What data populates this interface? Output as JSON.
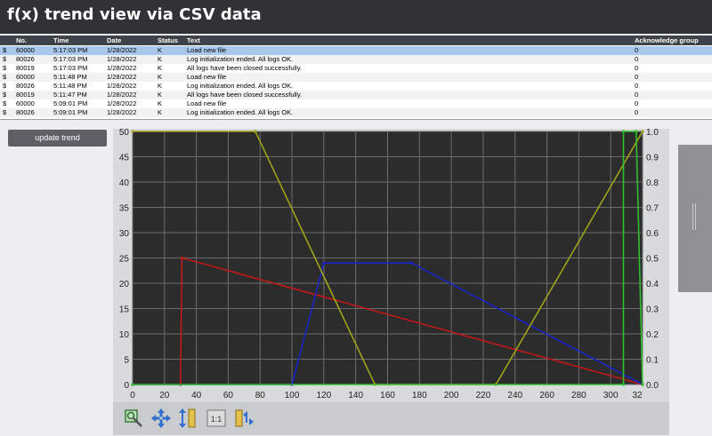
{
  "window": {
    "title": "f(x) trend view via CSV data"
  },
  "log_table": {
    "columns": [
      "No.",
      "Time",
      "Date",
      "Status",
      "Text",
      "Acknowledge group"
    ],
    "rows": [
      {
        "icon": "$",
        "no": "60000",
        "time": "5:17:03 PM",
        "date": "1/28/2022",
        "status": "K",
        "text": "Load new file",
        "ack": "0"
      },
      {
        "icon": "$",
        "no": "80026",
        "time": "5:17:03 PM",
        "date": "1/28/2022",
        "status": "K",
        "text": "Log initialization ended. All logs OK.",
        "ack": "0"
      },
      {
        "icon": "$",
        "no": "80019",
        "time": "5:17:03 PM",
        "date": "1/28/2022",
        "status": "K",
        "text": "All logs have been closed successfully.",
        "ack": "0"
      },
      {
        "icon": "$",
        "no": "60000",
        "time": "5:11:48 PM",
        "date": "1/28/2022",
        "status": "K",
        "text": "Load new file",
        "ack": "0"
      },
      {
        "icon": "$",
        "no": "80026",
        "time": "5:11:48 PM",
        "date": "1/28/2022",
        "status": "K",
        "text": "Log initialization ended. All logs OK.",
        "ack": "0"
      },
      {
        "icon": "$",
        "no": "80019",
        "time": "5:11:47 PM",
        "date": "1/28/2022",
        "status": "K",
        "text": "All logs have been closed successfully.",
        "ack": "0"
      },
      {
        "icon": "$",
        "no": "60000",
        "time": "5:09:01 PM",
        "date": "1/28/2022",
        "status": "K",
        "text": "Load new file",
        "ack": "0"
      },
      {
        "icon": "$",
        "no": "80026",
        "time": "5:09:01 PM",
        "date": "1/28/2022",
        "status": "K",
        "text": "Log initialization ended. All logs OK.",
        "ack": "0"
      }
    ]
  },
  "update_button": "update trend",
  "toolbar_icons": [
    "zoom-area-icon",
    "pan-icon",
    "zoom-y-icon",
    "reset-zoom-icon",
    "zoom-x-icon"
  ],
  "toolbar_reset_label": "1:1",
  "chart_data": {
    "type": "line",
    "background": "#2c2c2c",
    "grid": true,
    "x_ticks": [
      "0",
      "20",
      "40",
      "60",
      "80",
      "100",
      "120",
      "140",
      "160",
      "180",
      "200",
      "220",
      "240",
      "260",
      "280",
      "300",
      "32"
    ],
    "x_range": [
      0,
      320
    ],
    "y_left_ticks": [
      "0",
      "5",
      "10",
      "15",
      "20",
      "25",
      "30",
      "35",
      "40",
      "45",
      "50"
    ],
    "y_left_range": [
      0,
      50
    ],
    "y_right_ticks": [
      "0.0",
      "0.1",
      "0.2",
      "0.3",
      "0.4",
      "0.5",
      "0.6",
      "0.7",
      "0.8",
      "0.9",
      "1.0"
    ],
    "y_right_range": [
      0,
      1
    ],
    "series": [
      {
        "color": "#c21818",
        "axis": "left",
        "points": [
          [
            0,
            0
          ],
          [
            30,
            0
          ],
          [
            31,
            25
          ],
          [
            320,
            0
          ]
        ]
      },
      {
        "color": "#1a25c8",
        "axis": "left",
        "points": [
          [
            0,
            0
          ],
          [
            100,
            0
          ],
          [
            120,
            24
          ],
          [
            175,
            24
          ],
          [
            320,
            0
          ]
        ]
      },
      {
        "color": "#9fa31a",
        "axis": "right",
        "points": [
          [
            0,
            1
          ],
          [
            77,
            1
          ],
          [
            152,
            0
          ],
          [
            228,
            0
          ],
          [
            320,
            1
          ]
        ]
      },
      {
        "color": "#2fbf2f",
        "axis": "right",
        "points": [
          [
            0,
            0
          ],
          [
            308,
            0
          ],
          [
            308,
            1
          ],
          [
            316,
            1
          ],
          [
            320,
            0
          ]
        ]
      }
    ]
  }
}
